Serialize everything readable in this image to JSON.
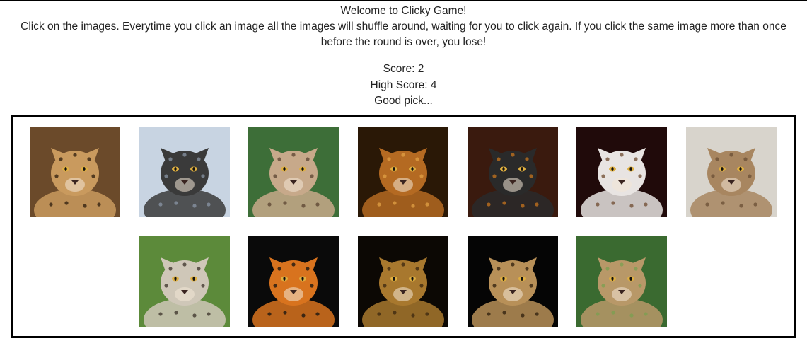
{
  "header": {
    "title": "Welcome to Clicky Game!",
    "instructions": "Click on the images. Everytime you click an image all the images will shuffle around, waiting for you to click again. If you click the same image more than once before the round is over, you lose!"
  },
  "scoreboard": {
    "score_text": "Score: 2",
    "high_score_text": "High Score: 4",
    "message": "Good pick..."
  },
  "cards": [
    {
      "animal": "cheetah",
      "bg": "#6b4a2a",
      "fur": "#c99a5e",
      "accent": "#2b1b0e"
    },
    {
      "animal": "kitten-with-flower",
      "bg": "#c8d4e2",
      "fur": "#3a3a3a",
      "accent": "#8a96a6"
    },
    {
      "animal": "lynx",
      "bg": "#3d6e38",
      "fur": "#c7a98a",
      "accent": "#5a4330"
    },
    {
      "animal": "lion",
      "bg": "#2a1806",
      "fur": "#b46a22",
      "accent": "#e2a246"
    },
    {
      "animal": "black-panther",
      "bg": "#3a1a0e",
      "fur": "#2a2a2a",
      "accent": "#c8761e"
    },
    {
      "animal": "white-kitten",
      "bg": "#200a0a",
      "fur": "#e8e4e2",
      "accent": "#6e4a2e"
    },
    {
      "animal": "cougar",
      "bg": "#d8d4cc",
      "fur": "#a88660",
      "accent": "#6a4e34"
    },
    {
      "animal": "ocelot",
      "bg": "#5c8a3a",
      "fur": "#cfc7b8",
      "accent": "#3a3028"
    },
    {
      "animal": "tiger",
      "bg": "#0a0a0a",
      "fur": "#d8731e",
      "accent": "#111111"
    },
    {
      "animal": "jaguar",
      "bg": "#0c0804",
      "fur": "#a8782e",
      "accent": "#3a2610"
    },
    {
      "animal": "leopard",
      "bg": "#050505",
      "fur": "#b89058",
      "accent": "#2e1e0c"
    },
    {
      "animal": "serval",
      "bg": "#3a6a30",
      "fur": "#b89868",
      "accent": "#7aa050"
    }
  ]
}
